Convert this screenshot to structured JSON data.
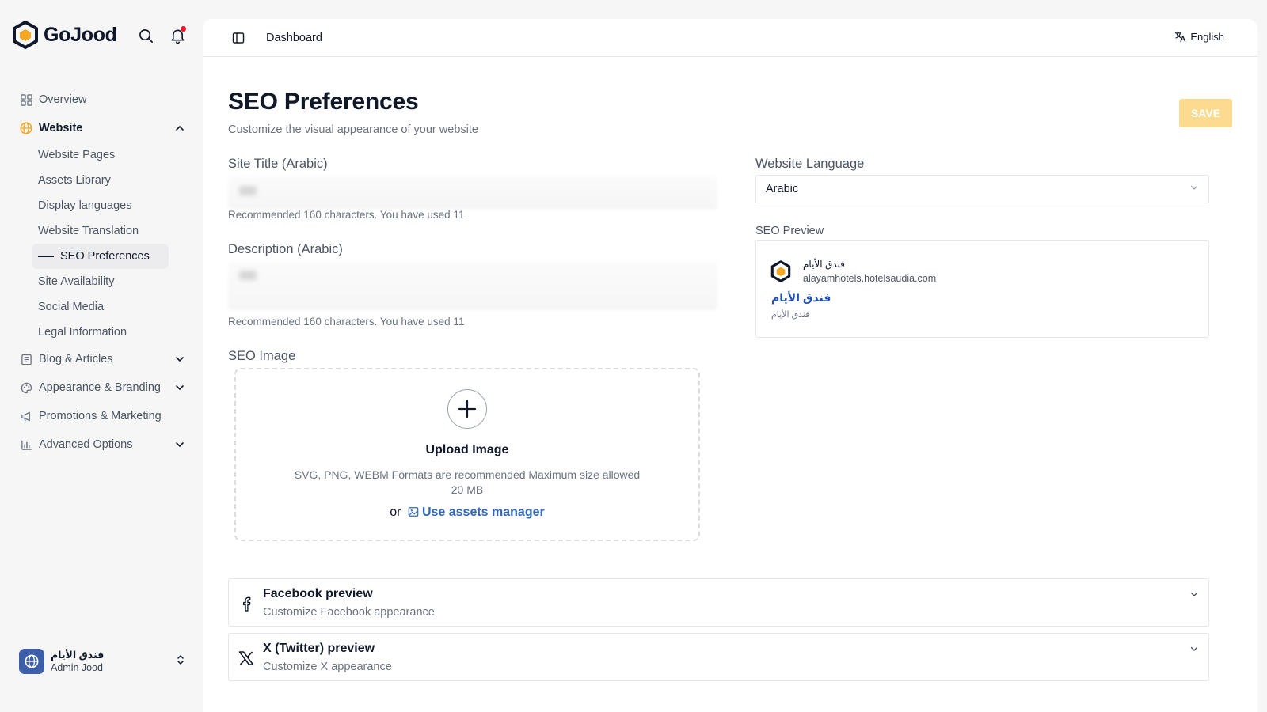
{
  "brand": {
    "name": "GoJood"
  },
  "sidebar": {
    "items": [
      {
        "label": "Overview"
      },
      {
        "label": "Website"
      },
      {
        "label": "Blog & Articles"
      },
      {
        "label": "Appearance & Branding"
      },
      {
        "label": "Promotions & Marketing"
      },
      {
        "label": "Advanced Options"
      }
    ],
    "website_sub": [
      {
        "label": "Website Pages"
      },
      {
        "label": "Assets Library"
      },
      {
        "label": "Display languages"
      },
      {
        "label": "Website Translation"
      },
      {
        "label": "SEO Preferences"
      },
      {
        "label": "Site Availability"
      },
      {
        "label": "Social Media"
      },
      {
        "label": "Legal Information"
      }
    ],
    "user": {
      "name": "فندق الأيام",
      "role": "Admin Jood"
    }
  },
  "topbar": {
    "breadcrumb": "Dashboard",
    "language": "English"
  },
  "page": {
    "title": "SEO Preferences",
    "subtitle": "Customize the visual appearance of your website",
    "save_label": "SAVE"
  },
  "form": {
    "site_title_label": "Site Title (Arabic)",
    "site_title_hint": "Recommended 160 characters. You have used 11",
    "description_label": "Description (Arabic)",
    "description_hint": "Recommended 160 characters. You have used 11",
    "seo_image_label": "SEO Image",
    "website_language_label": "Website Language",
    "website_language_value": "Arabic"
  },
  "upload": {
    "title": "Upload Image",
    "hint": "SVG, PNG, WEBM Formats are recommended Maximum size allowed 20 MB",
    "or": "or",
    "assets_link": "Use assets manager"
  },
  "seo_preview": {
    "label": "SEO Preview",
    "site_name": "فندق الأيام",
    "url": "alayamhotels.hotelsaudia.com",
    "title": "فندق الأيام",
    "description": "فندق الأيام"
  },
  "accordions": [
    {
      "title": "Facebook preview",
      "subtitle": "Customize Facebook appearance"
    },
    {
      "title": "X (Twitter) preview",
      "subtitle": "Customize X appearance"
    }
  ],
  "colors": {
    "accent": "#f5a623",
    "save_disabled": "#fbdb8f",
    "link": "#3168b8",
    "seo_title": "#2350b8",
    "avatar": "#3d5fa8",
    "notification": "#e11d2e"
  }
}
